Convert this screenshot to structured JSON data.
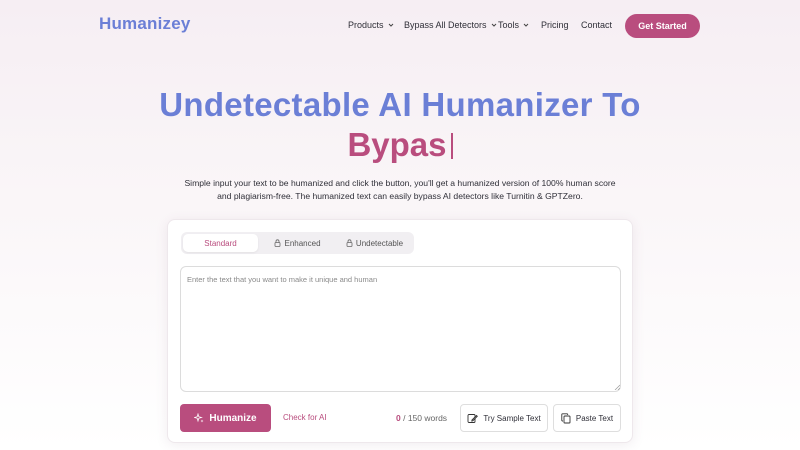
{
  "header": {
    "logo": "Humanizey",
    "nav": [
      {
        "label": "Products"
      },
      {
        "label": "Bypass All Detectors"
      },
      {
        "label": "Tools"
      },
      {
        "label": "Pricing"
      },
      {
        "label": "Contact"
      }
    ],
    "cta_label": "Get Started"
  },
  "hero": {
    "title": "Undetectable AI Humanizer To",
    "typed_text": "Bypas",
    "description": "Simple input your text to be humanized and click the button, you'll get a humanized version of 100% human score and plagiarism-free. The humanized text can easily bypass AI detectors like Turnitin & GPTZero."
  },
  "editor": {
    "tabs": [
      {
        "label": "Standard",
        "active": true,
        "locked": false
      },
      {
        "label": "Enhanced",
        "active": false,
        "locked": true
      },
      {
        "label": "Undetectable",
        "active": false,
        "locked": true
      }
    ],
    "placeholder": "Enter the text that you want to make it unique and human",
    "value": "",
    "humanize_label": "Humanize",
    "check_ai_label": "Check for AI",
    "word_count": "0",
    "word_limit": "/ 150 words",
    "sample_label": "Try Sample Text",
    "paste_label": "Paste Text"
  },
  "colors": {
    "accent": "#b94d7e",
    "brand_blue": "#6b7fd6"
  }
}
